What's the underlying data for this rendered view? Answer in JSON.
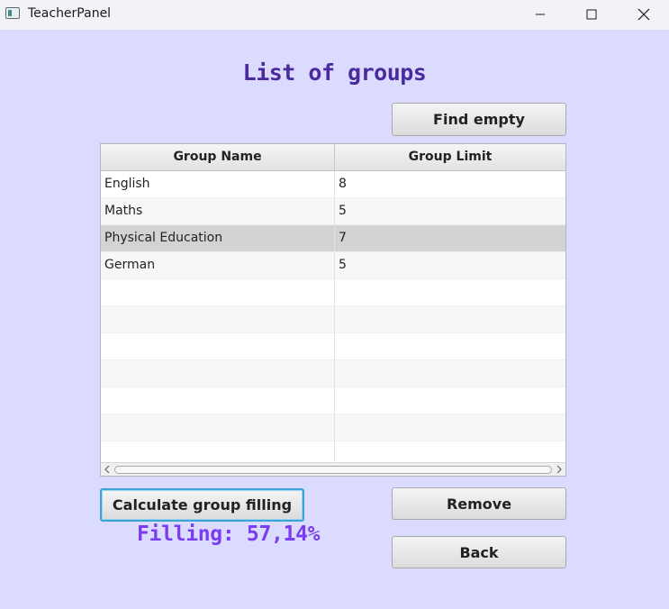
{
  "window": {
    "title": "TeacherPanel"
  },
  "heading": "List of groups",
  "buttons": {
    "find_empty": "Find empty",
    "calculate": "Calculate group filling",
    "remove": "Remove",
    "back": "Back"
  },
  "table": {
    "columns": [
      "Group Name",
      "Group Limit"
    ],
    "rows": [
      {
        "name": "English",
        "limit": "8"
      },
      {
        "name": "Maths",
        "limit": "5"
      },
      {
        "name": "Physical Education",
        "limit": "7"
      },
      {
        "name": "German",
        "limit": "5"
      }
    ],
    "selected_row": 2
  },
  "filling_text": "Filling: 57,14%",
  "colors": {
    "background": "#dadbfe",
    "heading": "#4b2a9e",
    "filling": "#7a3cf0",
    "focus_ring": "#3aa4d8",
    "selected_row": "#d3d3d3"
  }
}
